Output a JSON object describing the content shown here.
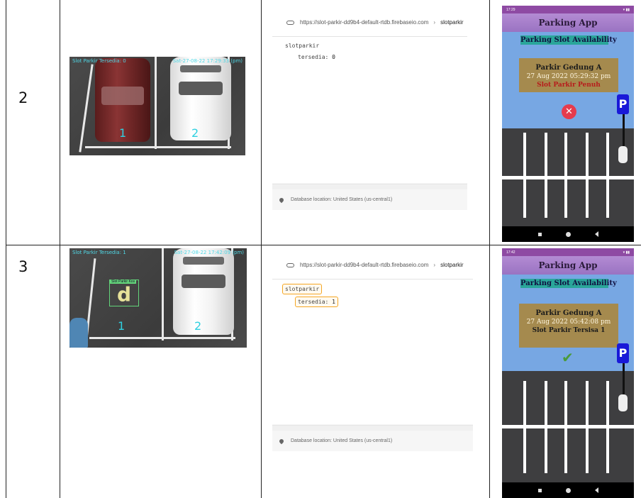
{
  "rows": [
    {
      "number": "2",
      "camera": {
        "overlay_left": "Slot Parkir Tersedia: 0",
        "overlay_right": "Sat-27-08-22 17:29:33 (pm)",
        "slot_1": "1",
        "slot_2": "2"
      },
      "database": {
        "url": "https://slot-parkir-dd9b4-default-rtdb.firebaseio.com",
        "node": "slotparkir",
        "root_key": "slotparkir",
        "child_key": "tersedia",
        "child_value": "0",
        "location": "Database location: United States (us-central1)"
      },
      "phone": {
        "time": "17:29",
        "app_title": "Parking App",
        "availability_label": "Parking Slot Availability",
        "location": "Parkir Gedung A",
        "datetime": "27 Aug 2022 05:29:32 pm",
        "status": "Slot Parkir Penuh",
        "status_color": "#b71c1c",
        "status_icon": "x-circle-icon",
        "sign": "P"
      }
    },
    {
      "number": "3",
      "camera": {
        "overlay_left": "Slot Parkir Tersedia: 1",
        "overlay_right": "Sat-27-08-22 17:42:09 (pm)",
        "detection_label": "Slot Parkir Kos",
        "detection_letter": "d",
        "slot_1": "1",
        "slot_2": "2"
      },
      "database": {
        "url": "https://slot-parkir-dd9b4-default-rtdb.firebaseio.com",
        "node": "slotparkir",
        "root_key": "slotparkir",
        "child_key": "tersedia",
        "child_value": "1",
        "location": "Database location: United States (us-central1)"
      },
      "phone": {
        "time": "17:42",
        "app_title": "Parking App",
        "availability_label": "Parking Slot Availability",
        "location": "Parkir Gedung A",
        "datetime": "27 Aug 2022 05:42:08 pm",
        "status": "Slot Parkir Tersisa 1",
        "status_color": "#1b1b1b",
        "status_icon": "checkmark-icon",
        "sign": "P"
      }
    }
  ]
}
